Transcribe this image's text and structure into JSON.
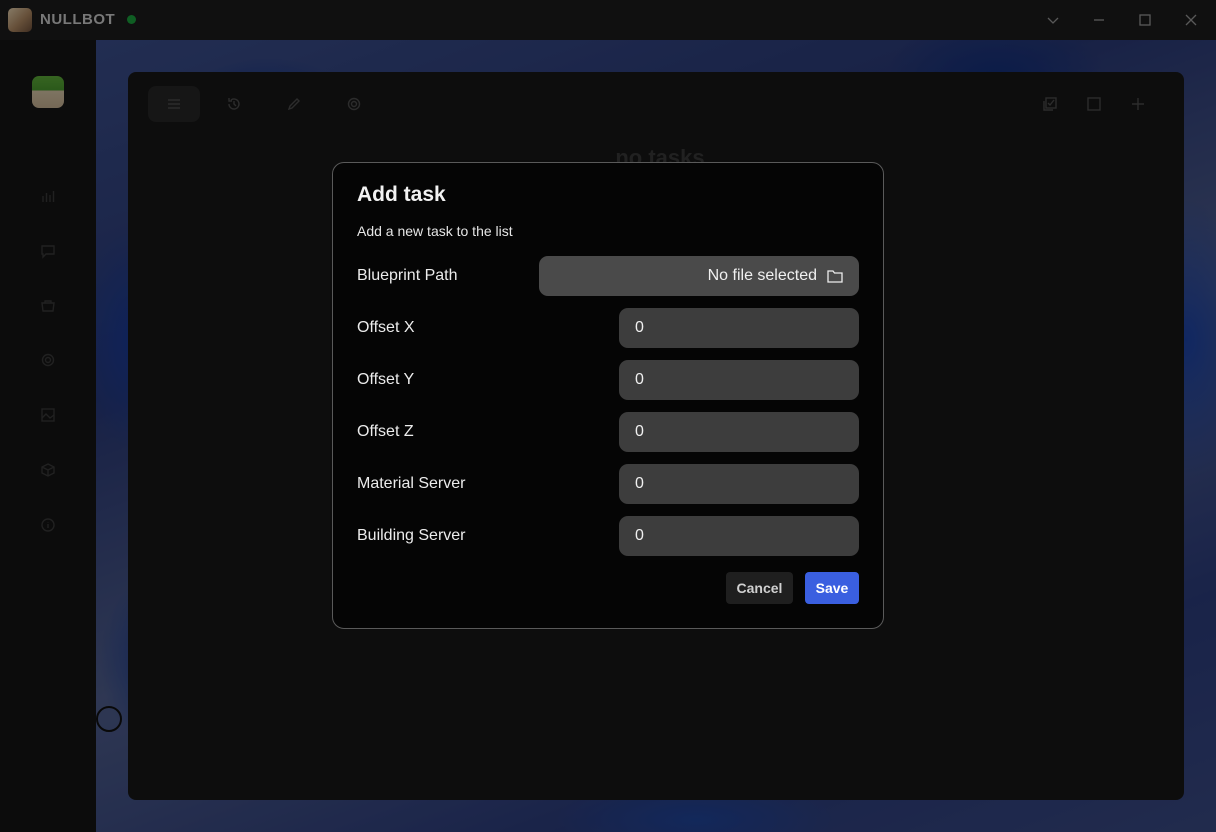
{
  "app": {
    "title": "NULLBOT",
    "status_color": "#1aa33d"
  },
  "window_controls": [
    {
      "name": "chevron-down-icon"
    },
    {
      "name": "minimize-icon"
    },
    {
      "name": "maximize-icon"
    },
    {
      "name": "close-icon"
    }
  ],
  "sidebar": {
    "icons": [
      "bar-chart-icon",
      "chat-icon",
      "shop-icon",
      "gear-icon",
      "image-icon",
      "cube-icon",
      "info-icon"
    ]
  },
  "toolbar": {
    "left": [
      "menu-icon",
      "history-icon",
      "pencil-icon",
      "settings-icon"
    ],
    "right": [
      "checklist-icon",
      "square-icon",
      "plus-icon"
    ]
  },
  "main": {
    "empty_label": "no tasks"
  },
  "dialog": {
    "title": "Add task",
    "description": "Add a new task to the list",
    "blueprint_label": "Blueprint Path",
    "blueprint_value": "No file selected",
    "fields": [
      {
        "label": "Offset X",
        "value": "0"
      },
      {
        "label": "Offset Y",
        "value": "0"
      },
      {
        "label": "Offset Z",
        "value": "0"
      },
      {
        "label": "Material Server",
        "value": "0"
      },
      {
        "label": "Building Server",
        "value": "0"
      }
    ],
    "cancel_label": "Cancel",
    "save_label": "Save",
    "accent_color": "#3a5fe0"
  }
}
